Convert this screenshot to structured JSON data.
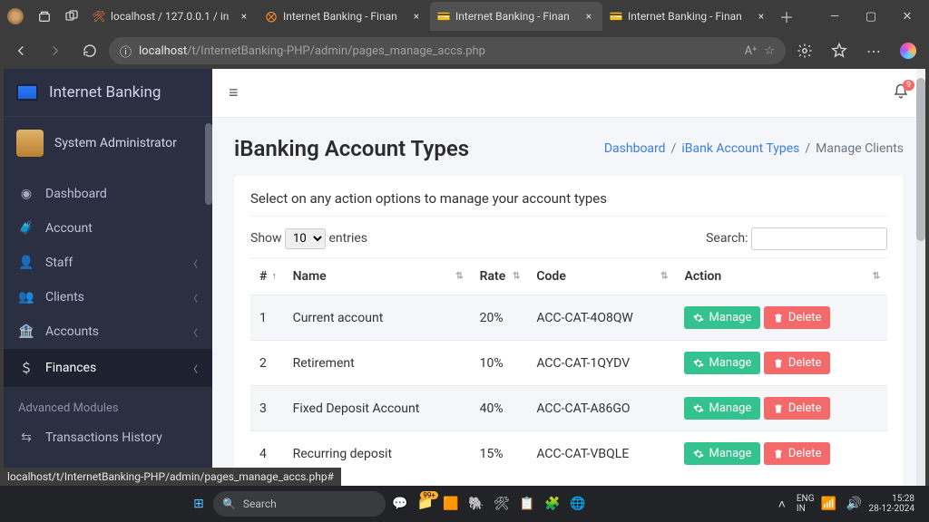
{
  "browser": {
    "tabs": [
      {
        "label": "localhost / 127.0.0.1 / in",
        "favicon": "🛠",
        "active": false
      },
      {
        "label": "Internet Banking - Finan",
        "favicon": "⨂",
        "active": false
      },
      {
        "label": "Internet Banking - Finan",
        "favicon": "💳",
        "active": true
      },
      {
        "label": "Internet Banking - Finan",
        "favicon": "💳",
        "active": false
      }
    ],
    "url_host": "localhost",
    "url_path": "/t/InternetBanking-PHP/admin/pages_manage_accs.php",
    "url_hint": "localhost/t/InternetBanking-PHP/admin/pages_manage_accs.php#"
  },
  "sidebar": {
    "brand": "Internet Banking",
    "user": "System Administrator",
    "items": [
      {
        "icon": "tachometer",
        "label": "Dashboard",
        "chevron": false
      },
      {
        "icon": "briefcase",
        "label": "Account",
        "chevron": false
      },
      {
        "icon": "user",
        "label": "Staff",
        "chevron": true
      },
      {
        "icon": "users",
        "label": "Clients",
        "chevron": true
      },
      {
        "icon": "bank",
        "label": "Accounts",
        "chevron": true
      },
      {
        "icon": "dollar",
        "label": "Finances",
        "chevron": true
      }
    ],
    "adv_heading": "Advanced Modules",
    "adv_items": [
      {
        "icon": "exchange",
        "label": "Transactions History"
      }
    ]
  },
  "topbar": {
    "bell_badge": "9"
  },
  "page": {
    "title": "iBanking Account Types",
    "crumbs": [
      "Dashboard",
      "iBank Account Types",
      "Manage Clients"
    ],
    "card_title": "Select on any action options to manage your account types",
    "show_label": "Show",
    "entries_label": "entries",
    "page_size": "10",
    "search_label": "Search:"
  },
  "table": {
    "columns": [
      "#",
      "Name",
      "Rate",
      "Code",
      "Action"
    ],
    "manage_label": "Manage",
    "delete_label": "Delete",
    "rows": [
      {
        "n": "1",
        "name": "Current account",
        "rate": "20%",
        "code": "ACC-CAT-4O8QW"
      },
      {
        "n": "2",
        "name": "Retirement",
        "rate": "10%",
        "code": "ACC-CAT-1QYDV"
      },
      {
        "n": "3",
        "name": "Fixed Deposit Account",
        "rate": "40%",
        "code": "ACC-CAT-A86GO"
      },
      {
        "n": "4",
        "name": "Recurring deposit",
        "rate": "15%",
        "code": "ACC-CAT-VBQLE"
      }
    ]
  },
  "taskbar": {
    "search_ph": "Search",
    "lang1": "ENG",
    "lang2": "IN",
    "time": "15:28",
    "date": "28-12-2024"
  }
}
